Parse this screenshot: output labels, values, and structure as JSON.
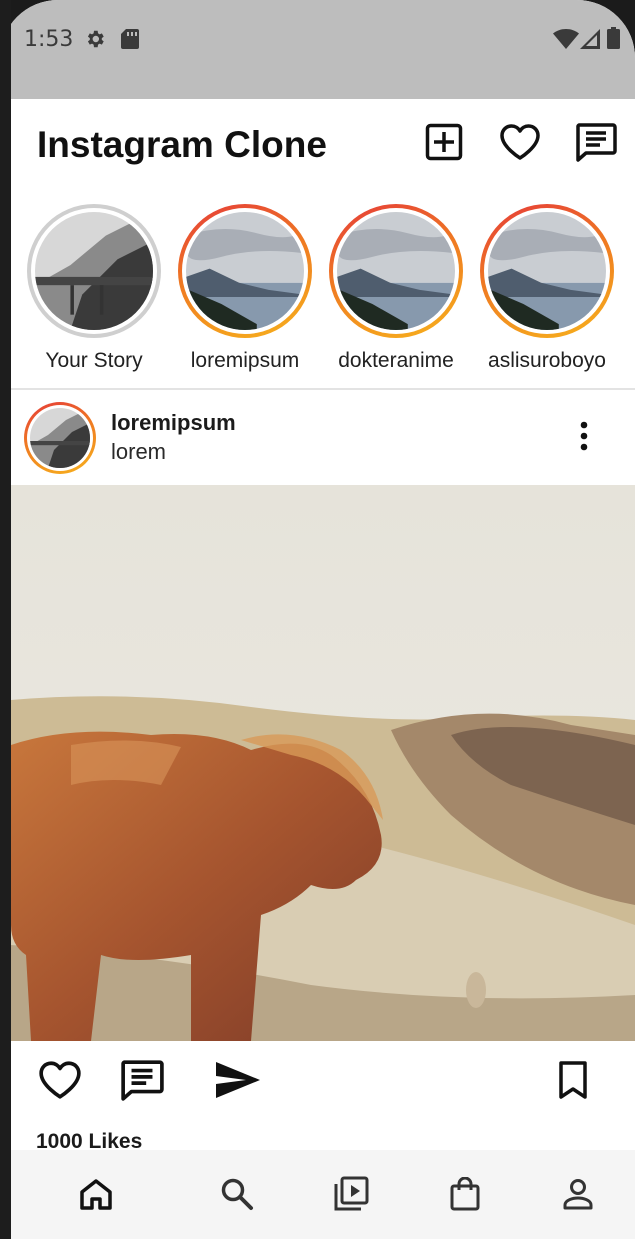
{
  "status_bar": {
    "time": "1:53",
    "icons": [
      "gear-icon",
      "sd-card-icon",
      "wifi-icon",
      "signal-icon",
      "battery-icon"
    ]
  },
  "header": {
    "title": "Instagram Clone",
    "actions": [
      "add-post-icon",
      "heart-icon",
      "messages-icon"
    ]
  },
  "stories": [
    {
      "label": "Your Story",
      "seen": true
    },
    {
      "label": "loremipsum",
      "seen": false
    },
    {
      "label": "dokteranime",
      "seen": false
    },
    {
      "label": "aslisuroboyo",
      "seen": false
    }
  ],
  "post": {
    "username": "loremipsum",
    "subtitle": "lorem",
    "likes": "1000 Likes",
    "actions": [
      "like-icon",
      "comment-icon",
      "share-icon",
      "bookmark-icon"
    ]
  },
  "bottom_nav": {
    "items": [
      "home-icon",
      "search-icon",
      "reels-icon",
      "shop-icon",
      "profile-icon"
    ],
    "active": "home-icon"
  },
  "colors": {
    "status_bar": "#bdbdbd",
    "story_ring_gradient": [
      "#e53a3a",
      "#ef7a22",
      "#f7b21c"
    ],
    "story_ring_seen": "#cfcfcf"
  }
}
